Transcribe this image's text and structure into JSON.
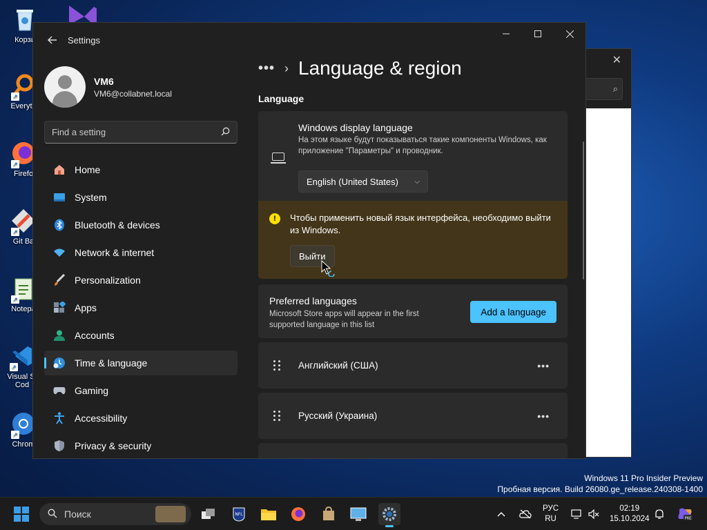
{
  "desktop": {
    "icons": [
      {
        "label": "Корзи",
        "icon": "recycle-bin-icon"
      },
      {
        "label": "Everyth",
        "icon": "search-app-icon"
      },
      {
        "label": "Firefo",
        "icon": "firefox-icon"
      },
      {
        "label": "Git Ba",
        "icon": "git-bash-icon"
      },
      {
        "label": "Notepa",
        "icon": "notepad-icon"
      },
      {
        "label": "Visual St Cod",
        "icon": "vscode-icon"
      },
      {
        "label": "Chrom",
        "icon": "chrome-icon"
      }
    ]
  },
  "settings": {
    "app_title": "Settings",
    "user": {
      "name": "VM6",
      "email": "VM6@collabnet.local"
    },
    "search_placeholder": "Find a setting",
    "nav": [
      {
        "label": "Home",
        "icon": "home-icon"
      },
      {
        "label": "System",
        "icon": "system-icon"
      },
      {
        "label": "Bluetooth & devices",
        "icon": "bluetooth-icon"
      },
      {
        "label": "Network & internet",
        "icon": "wifi-icon"
      },
      {
        "label": "Personalization",
        "icon": "brush-icon"
      },
      {
        "label": "Apps",
        "icon": "apps-icon"
      },
      {
        "label": "Accounts",
        "icon": "accounts-icon"
      },
      {
        "label": "Time & language",
        "icon": "time-language-icon",
        "active": true
      },
      {
        "label": "Gaming",
        "icon": "gaming-icon"
      },
      {
        "label": "Accessibility",
        "icon": "accessibility-icon"
      },
      {
        "label": "Privacy & security",
        "icon": "shield-icon"
      }
    ],
    "breadcrumb_dots": "•••",
    "page_title": "Language & region",
    "section_language": "Language",
    "display_language": {
      "title": "Windows display language",
      "description": "На этом языке будут показываться такие компоненты Windows, как приложение \"Параметры\" и проводник.",
      "selected": "English (United States)"
    },
    "warning": {
      "text": "Чтобы применить новый язык интерфейса, необходимо выйти из Windows.",
      "button": "Выйти"
    },
    "preferred": {
      "title": "Preferred languages",
      "description": "Microsoft Store apps will appear in the first supported language in this list",
      "add_button": "Add a language"
    },
    "languages": [
      "Английский (США)",
      "Русский (Украина)"
    ]
  },
  "watermark": {
    "line1": "Windows 11 Pro Insider Preview",
    "line2": "Пробная версия. Build 26080.ge_release.240308-1400"
  },
  "taskbar": {
    "search_label": "Поиск",
    "lang_top": "РУС",
    "lang_bottom": "RU",
    "time": "02:19",
    "date": "15.10.2024"
  },
  "colors": {
    "accent": "#4cc2ff",
    "warning_bg": "#433519",
    "window_bg": "#202020",
    "card_bg": "#2b2b2b"
  }
}
